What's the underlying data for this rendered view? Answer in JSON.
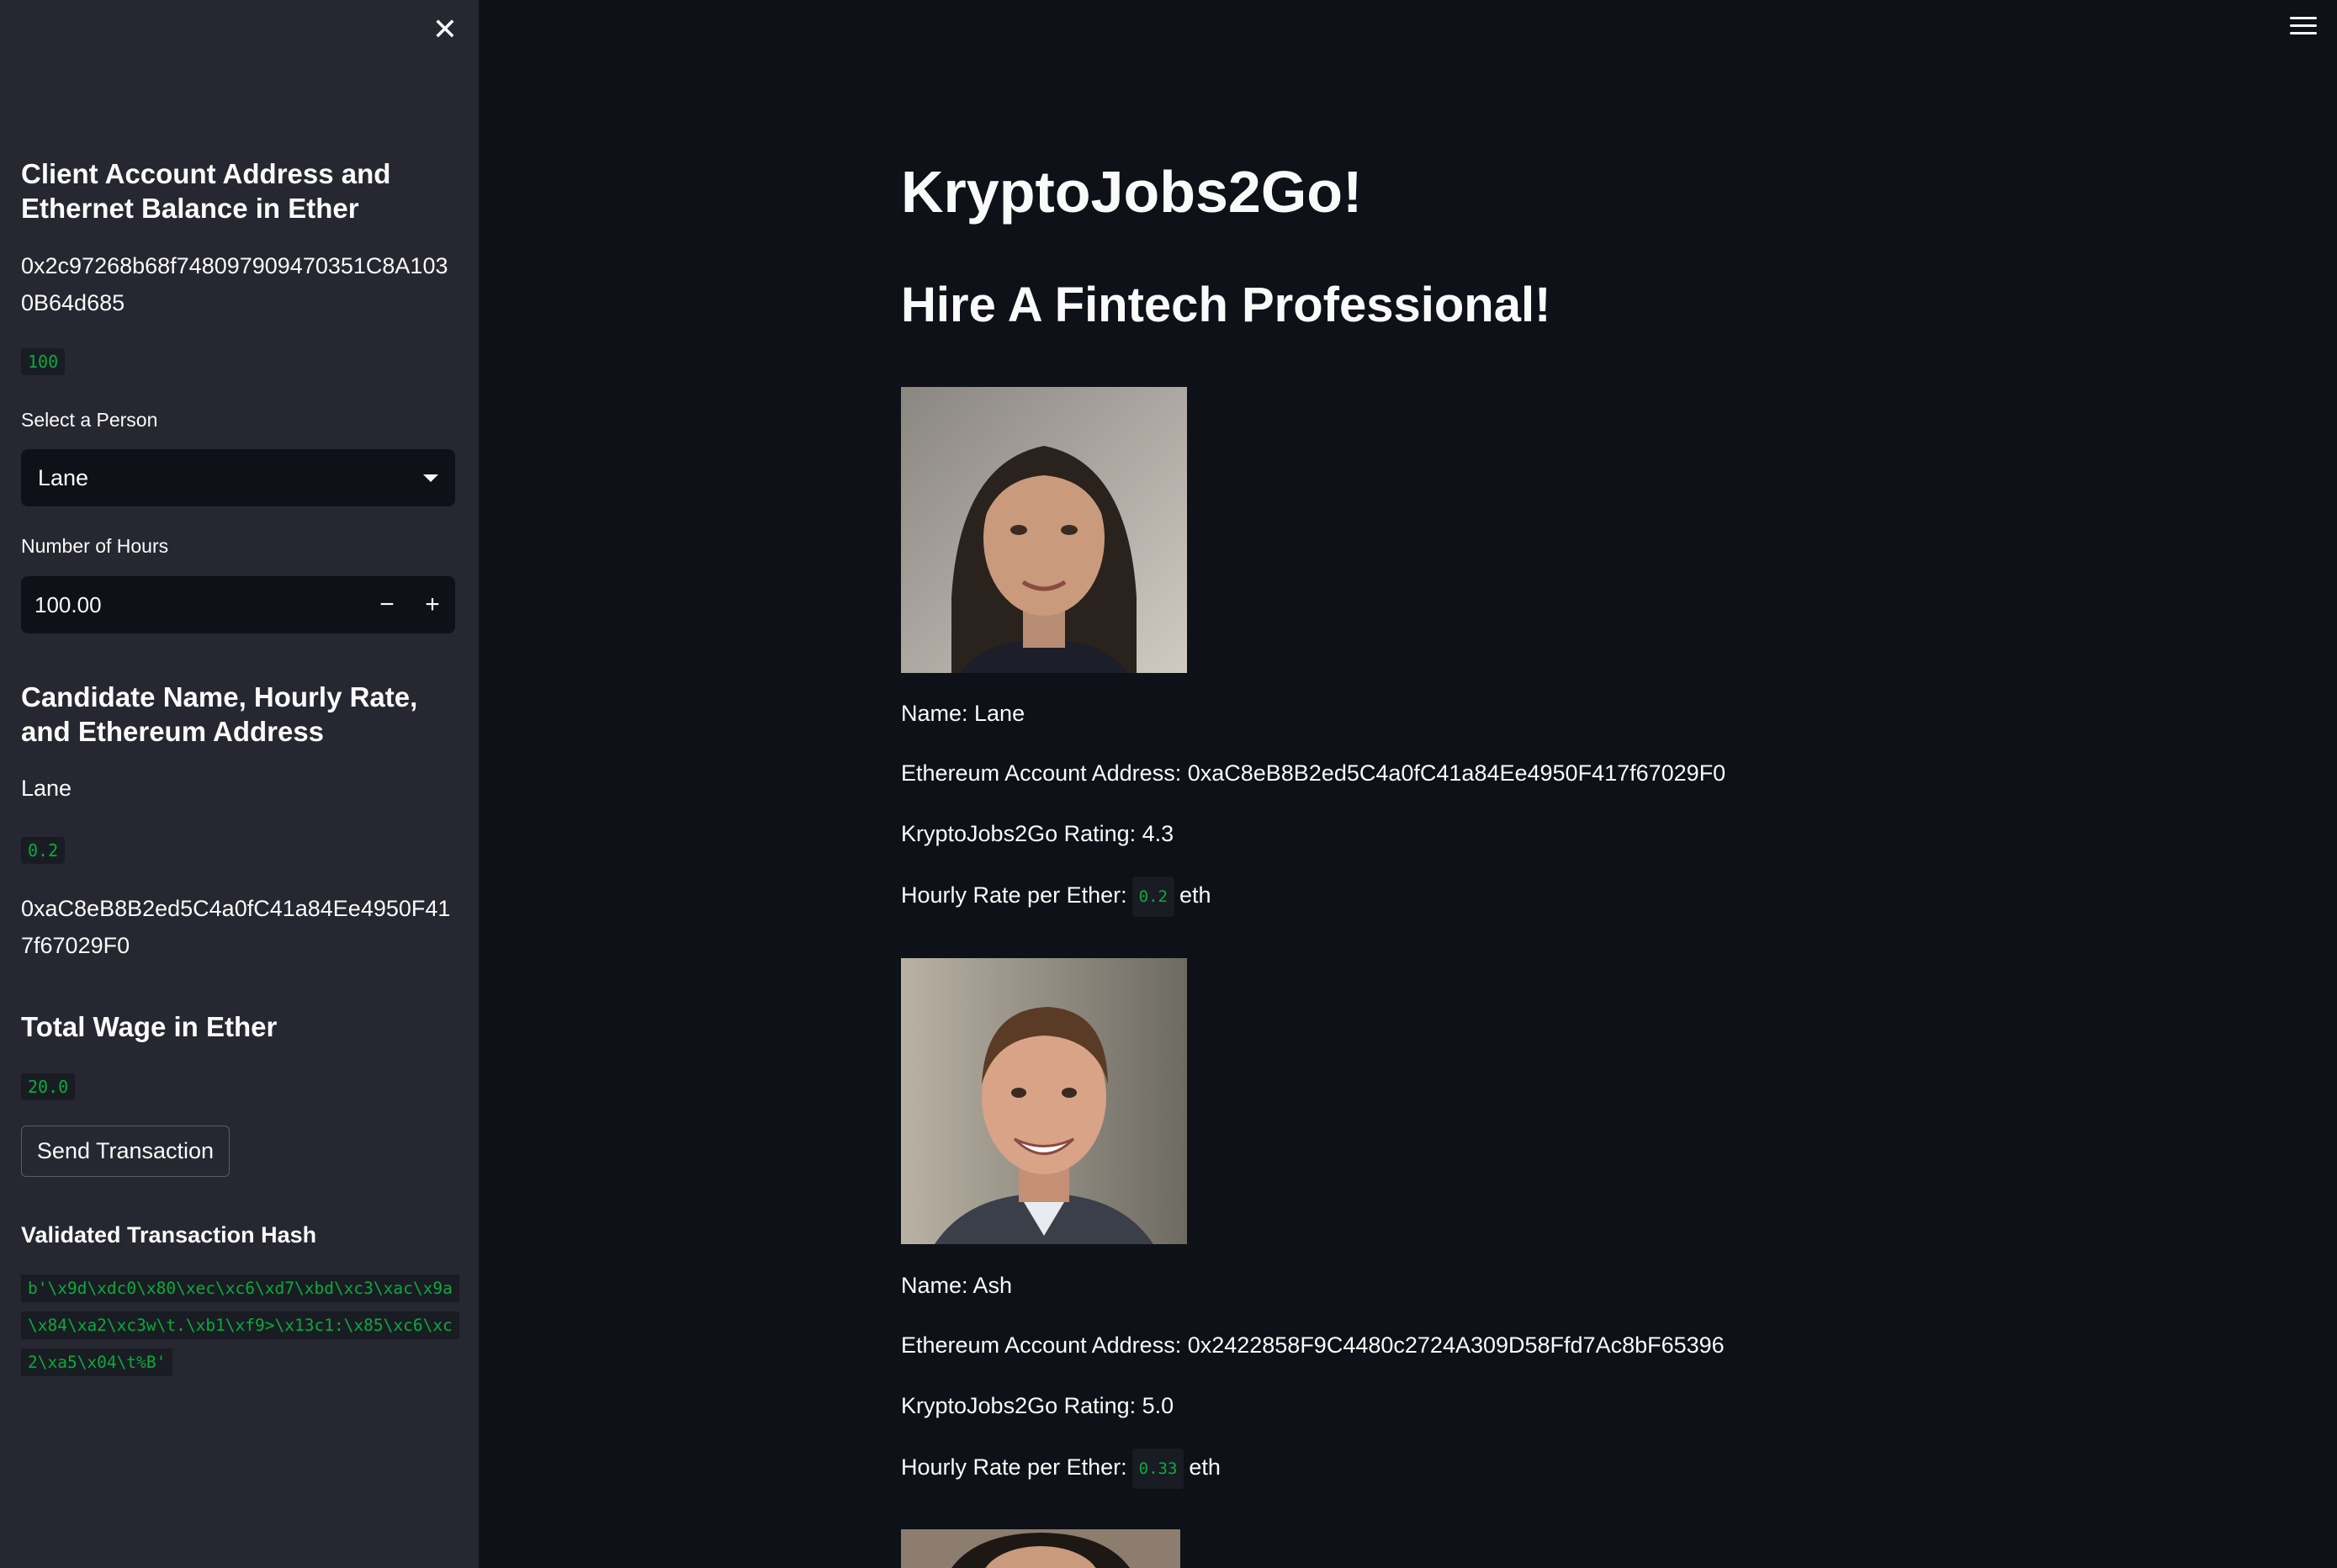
{
  "sidebar": {
    "client_heading": "Client Account Address and Ethernet Balance in Ether",
    "client_address": "0x2c97268b68f748097909470351C8A1030B64d685",
    "client_balance": "100",
    "select_label": "Select a Person",
    "select_value": "Lane",
    "hours_label": "Number of Hours",
    "hours_value": "100.00",
    "candidate_heading": "Candidate Name, Hourly Rate, and Ethereum Address",
    "candidate_name": "Lane",
    "candidate_rate": "0.2",
    "candidate_address": "0xaC8eB8B2ed5C4a0fC41a84Ee4950F417f67029F0",
    "total_heading": "Total Wage in Ether",
    "total_value": "20.0",
    "send_button": "Send Transaction",
    "hash_heading": "Validated Transaction Hash",
    "hash_value": "b'\\x9d\\xdc0\\x80\\xec\\xc6\\xd7\\xbd\\xc3\\xac\\x9a\\x84\\xa2\\xc3w\\t.\\xb1\\xf9>\\x13c1:\\x85\\xc6\\xc2\\xa5\\x04\\t%B'"
  },
  "main": {
    "title": "KryptoJobs2Go!",
    "subtitle": "Hire A Fintech Professional!",
    "candidates": [
      {
        "name_text": "Name: Lane",
        "address_text": "Ethereum Account Address: 0xaC8eB8B2ed5C4a0fC41a84Ee4950F417f67029F0",
        "rating_text": "KryptoJobs2Go Rating: 4.3",
        "rate_label": "Hourly Rate per Ether:",
        "rate_value": "0.2",
        "rate_unit": "eth"
      },
      {
        "name_text": "Name: Ash",
        "address_text": "Ethereum Account Address: 0x2422858F9C4480c2724A309D58Ffd7Ac8bF65396",
        "rating_text": "KryptoJobs2Go Rating: 5.0",
        "rate_label": "Hourly Rate per Ether:",
        "rate_value": "0.33",
        "rate_unit": "eth"
      }
    ]
  },
  "icons": {
    "close": "close-icon",
    "menu": "hamburger-menu-icon",
    "select_caret": "caret-down-icon",
    "minus": "minus-icon",
    "plus": "plus-icon"
  },
  "colors": {
    "background": "#0e1117",
    "sidebar": "#262730",
    "code_text": "#09ab3b"
  }
}
